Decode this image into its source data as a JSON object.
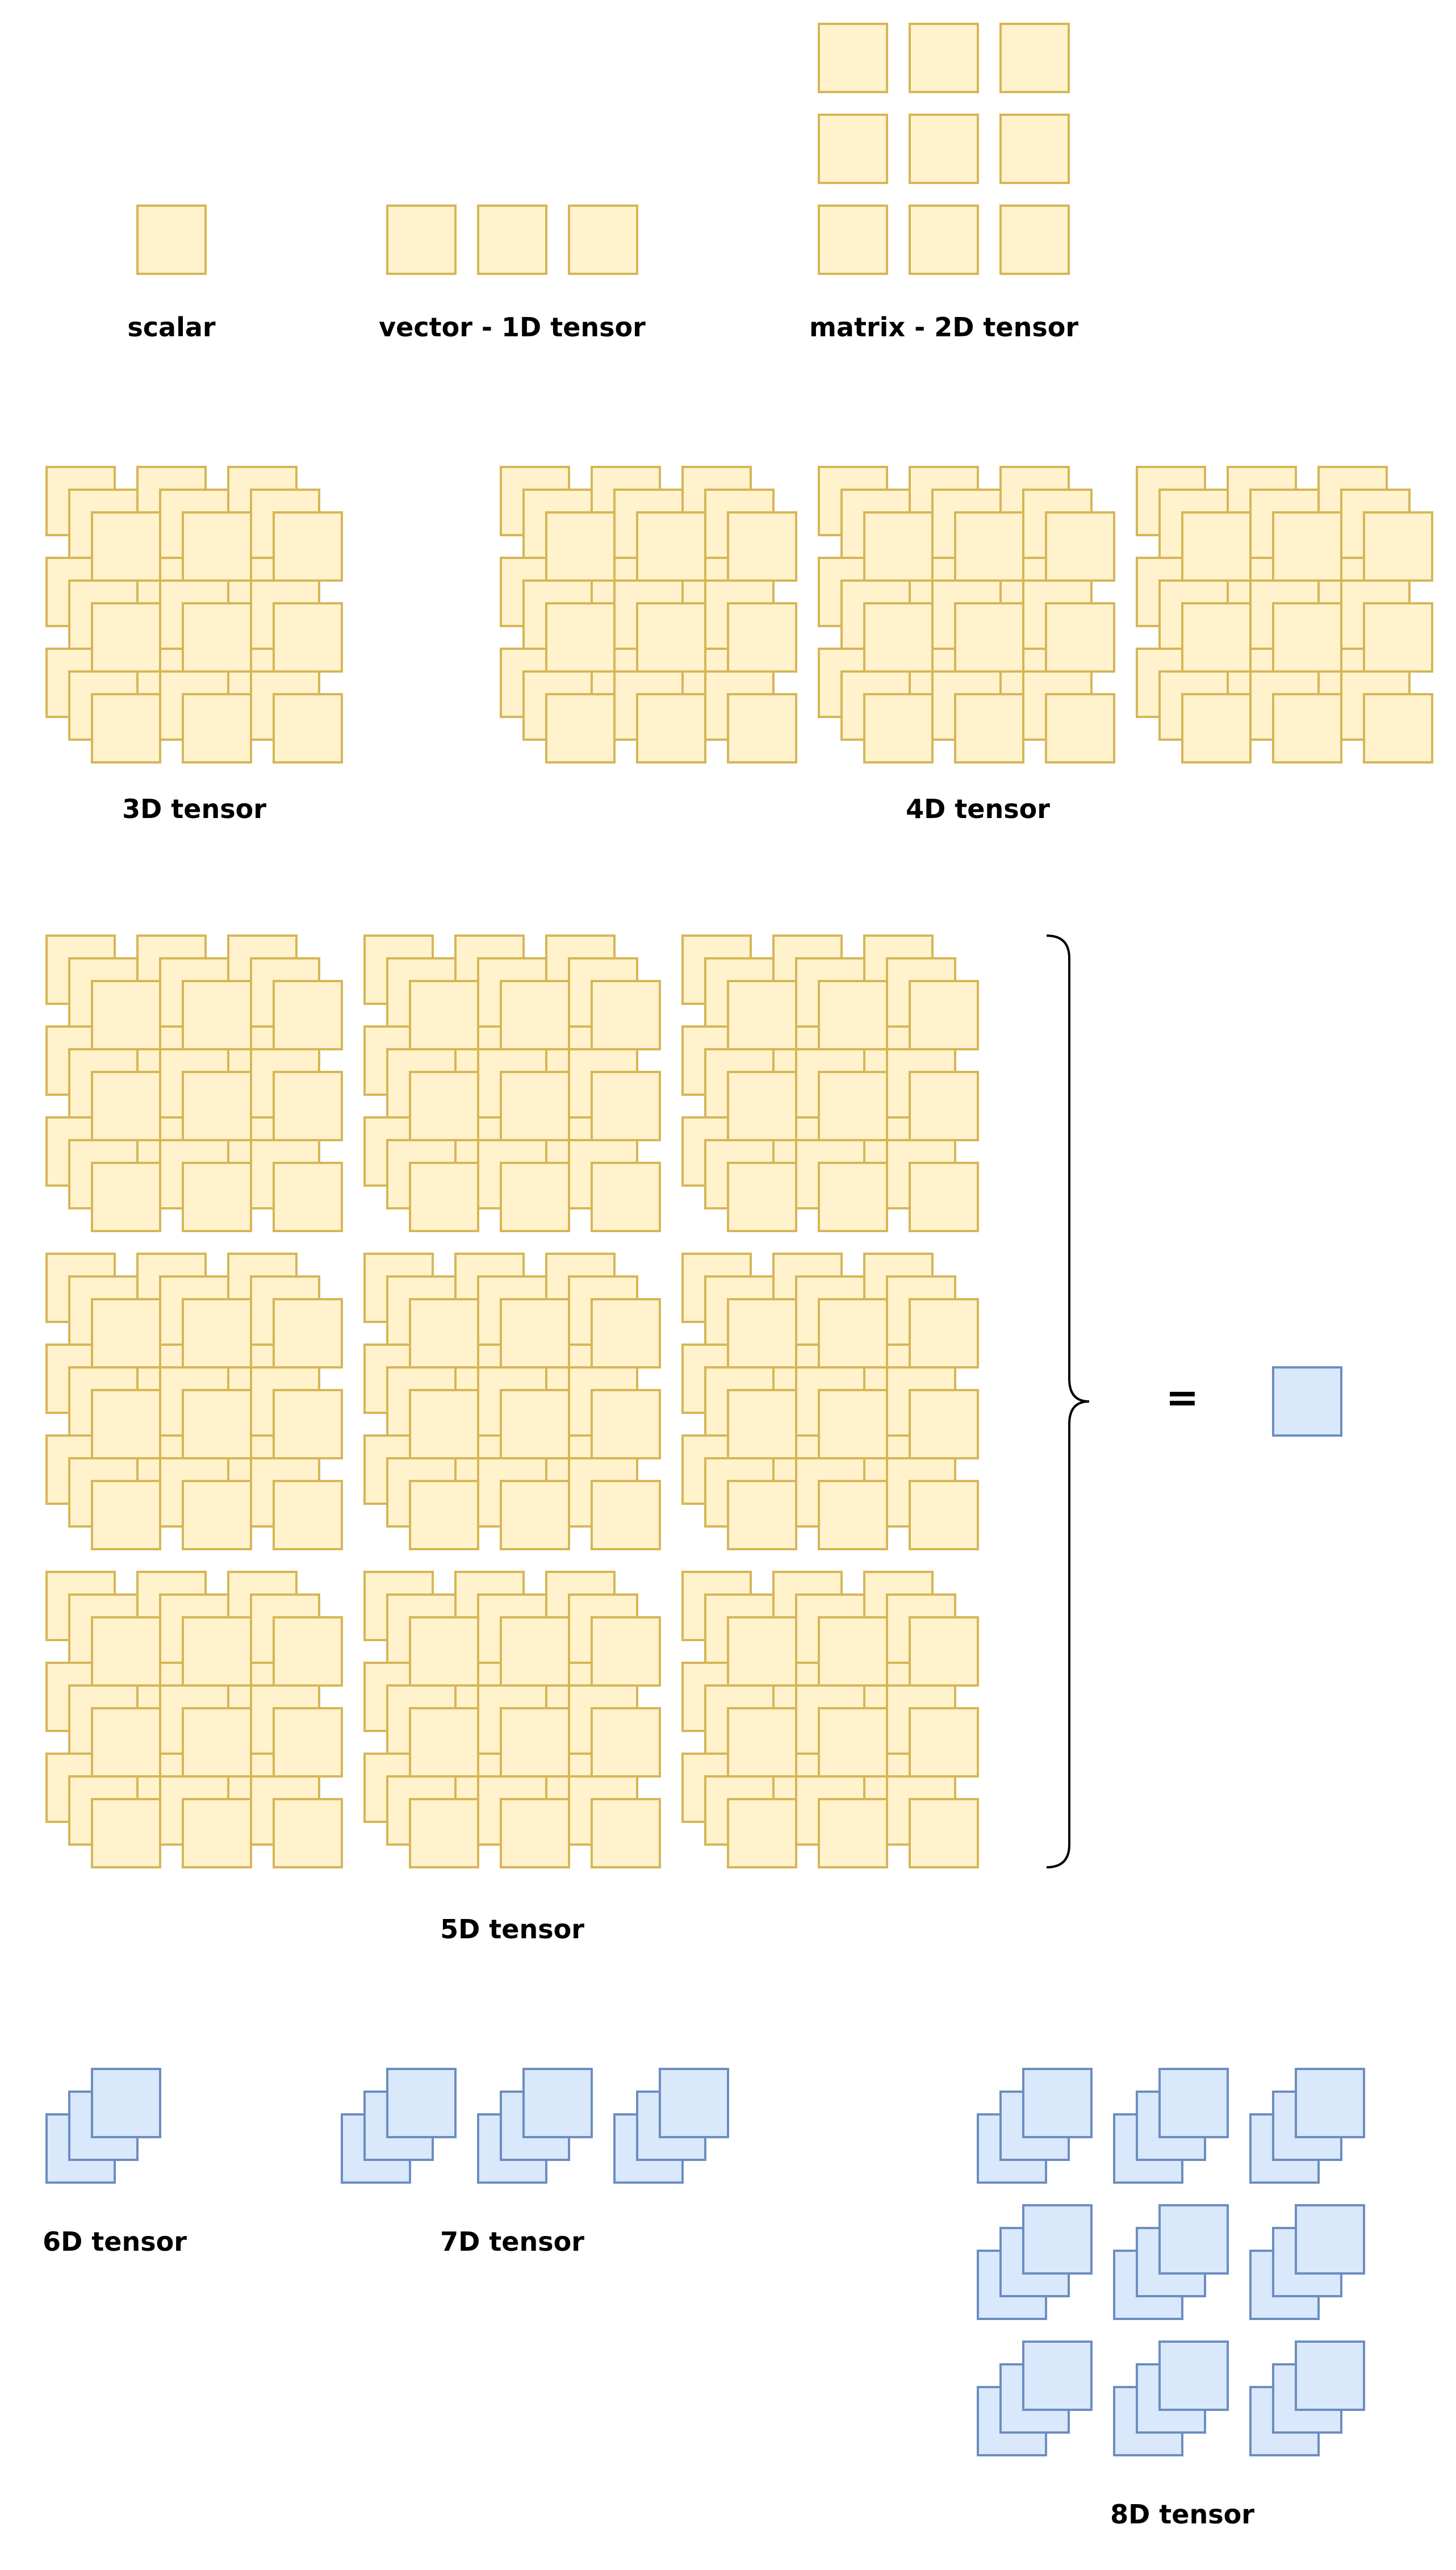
{
  "labels": {
    "scalar": "scalar",
    "vector": "vector - 1D tensor",
    "matrix": "matrix - 2D tensor",
    "tensor3d": "3D tensor",
    "tensor4d": "4D tensor",
    "tensor5d": "5D tensor",
    "equals": "=",
    "tensor6d": "6D tensor",
    "tensor7d": "7D tensor",
    "tensor8d": "8D tensor"
  },
  "colors": {
    "yellow_fill": "#fff2cc",
    "yellow_stroke": "#d6b656",
    "blue_fill": "#dae8fc",
    "blue_stroke": "#6c8ebf",
    "line": "#000000"
  }
}
